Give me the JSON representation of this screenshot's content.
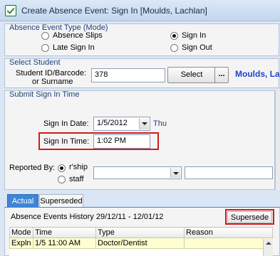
{
  "window": {
    "title": "Create Absence Event: Sign In [Moulds, Lachlan]"
  },
  "event_type": {
    "legend": "Absence Event Type (Mode)",
    "options": [
      {
        "label": "Absence Slips",
        "selected": false
      },
      {
        "label": "Sign In",
        "selected": true
      },
      {
        "label": "Late Sign In",
        "selected": false
      },
      {
        "label": "Sign Out",
        "selected": false
      }
    ]
  },
  "student": {
    "legend": "Select Student",
    "field_label_line1": "Student ID/Barcode:",
    "field_label_line2": "or Surname",
    "value": "378",
    "select_button": "Select",
    "more_button": "...",
    "name_display": "Moulds, La"
  },
  "submit": {
    "legend": "Submit Sign In Time",
    "date_label": "Sign In Date:",
    "date_value": "1/5/2012",
    "day": "Thu",
    "time_label": "Sign In Time:",
    "time_value": "1:02 PM",
    "reported_by_label": "Reported By:",
    "reported_options": [
      {
        "label": "r'ship",
        "selected": true
      },
      {
        "label": "staff",
        "selected": false
      }
    ]
  },
  "tabs": [
    {
      "label": "Actual",
      "active": true
    },
    {
      "label": "Superseded",
      "active": false
    }
  ],
  "history": {
    "title": "Absence Events History 29/12/11 - 12/01/12",
    "supersede_button": "Supersede",
    "columns": [
      "Mode",
      "Time",
      "Type",
      "Reason"
    ],
    "rows": [
      [
        "Expln",
        "1/5 11:00 AM",
        "Doctor/Dentist",
        ""
      ]
    ]
  },
  "colors": {
    "highlight": "#d01b1b",
    "accent": "#1f3f7a",
    "name_text": "#1b46c8",
    "active_tab": "#3d85d8"
  }
}
